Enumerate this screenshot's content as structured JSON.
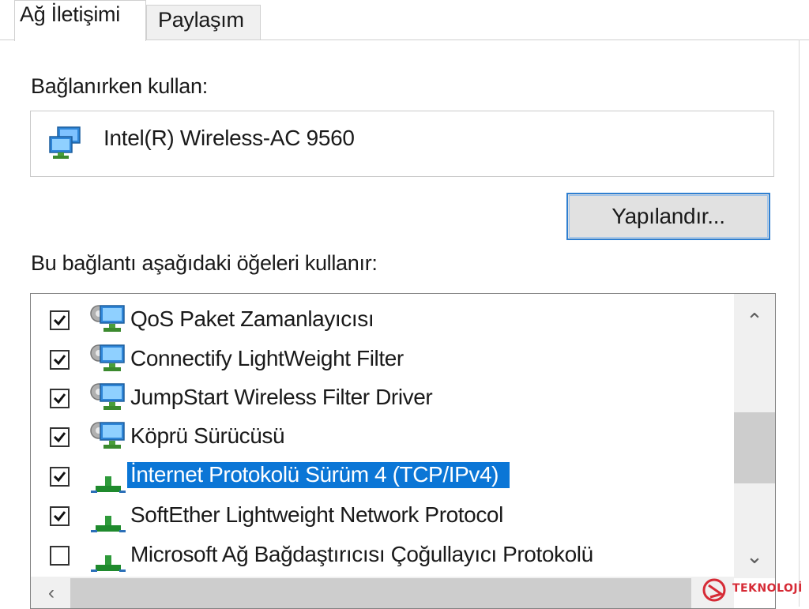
{
  "tabs": [
    {
      "label": "Ağ İletişimi",
      "active": true
    },
    {
      "label": "Paylaşım",
      "active": false
    }
  ],
  "connect_using_label": "Bağlanırken kullan:",
  "adapter": {
    "name": "Intel(R) Wireless-AC 9560",
    "icon": "network-adapter-icon"
  },
  "configure_button": "Yapılandır...",
  "items_label": "Bu bağlantı aşağıdaki öğeleri kullanır:",
  "items": [
    {
      "label": "QoS Paket Zamanlayıcısı",
      "checked": true,
      "icon": "service-icon"
    },
    {
      "label": "Connectify LightWeight Filter",
      "checked": true,
      "icon": "service-icon"
    },
    {
      "label": "JumpStart Wireless Filter Driver",
      "checked": true,
      "icon": "service-icon"
    },
    {
      "label": "Köprü Sürücüsü",
      "checked": true,
      "icon": "service-icon"
    },
    {
      "label": "İnternet Protokolü Sürüm 4 (TCP/IPv4)",
      "checked": true,
      "icon": "protocol-icon",
      "selected": true
    },
    {
      "label": "SoftEther Lightweight Network Protocol",
      "checked": true,
      "icon": "protocol-icon"
    },
    {
      "label": "Microsoft Ağ Bağdaştırıcısı Çoğullayıcı Protokolü",
      "checked": false,
      "icon": "protocol-icon"
    }
  ],
  "watermark": {
    "text": "TEKNOLOJİ"
  },
  "colors": {
    "selection": "#0b76d6",
    "button_border": "#2f7fd0",
    "watermark": "#d62b36"
  }
}
